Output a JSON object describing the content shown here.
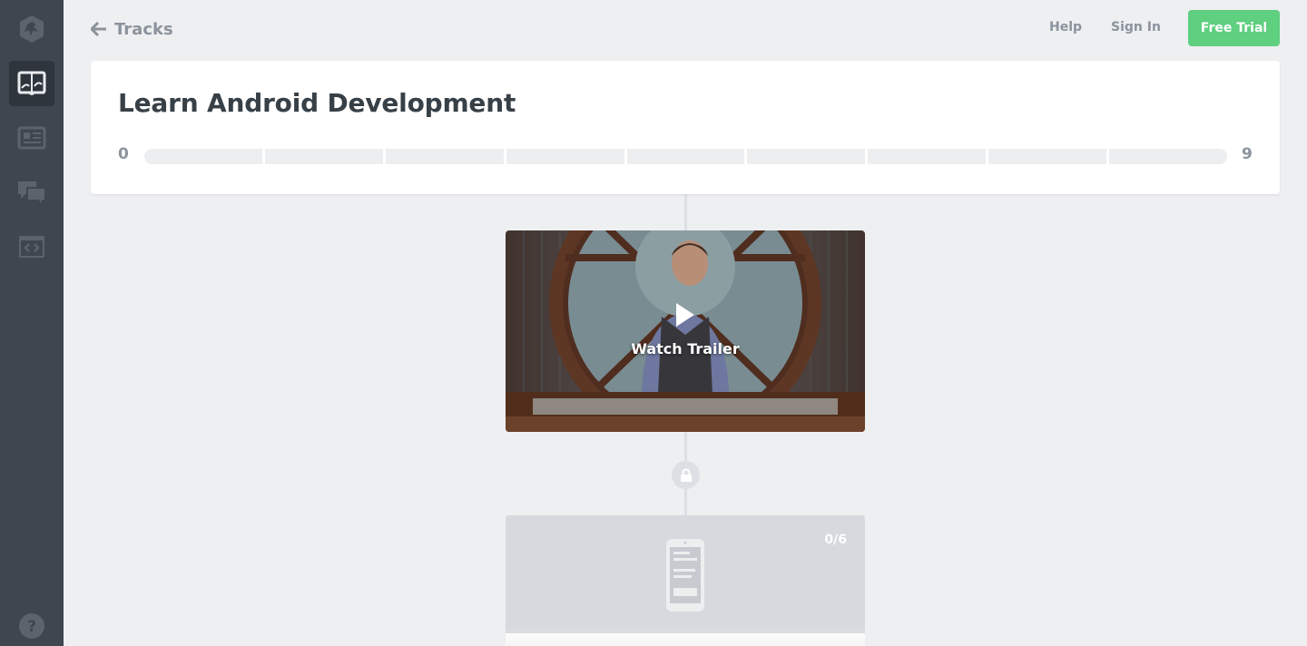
{
  "sidebar": {
    "items": [
      {
        "icon": "treehouse-logo-icon"
      },
      {
        "icon": "tracks-book-icon",
        "active": true
      },
      {
        "icon": "library-icon"
      },
      {
        "icon": "community-chat-icon"
      },
      {
        "icon": "workspaces-code-icon"
      }
    ],
    "help_icon": "help-question-icon"
  },
  "header": {
    "back_label": "Tracks",
    "help_label": "Help",
    "signin_label": "Sign In",
    "trial_label": "Free Trial",
    "trial_color": "#5fcf80"
  },
  "track": {
    "title": "Learn Android Development",
    "progress_start": "0",
    "progress_end": "9",
    "progress_value": 0
  },
  "trailer": {
    "label": "Watch Trailer"
  },
  "course": {
    "count": "0/6"
  }
}
